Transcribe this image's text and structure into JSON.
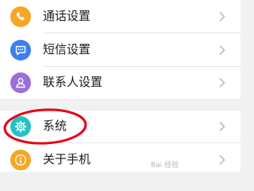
{
  "settings": {
    "items": [
      {
        "label": "通话设置",
        "icon": "phone-icon",
        "icon_color": "#f5a623"
      },
      {
        "label": "短信设置",
        "icon": "message-icon",
        "icon_color": "#3d7ef0"
      },
      {
        "label": "联系人设置",
        "icon": "contact-icon",
        "icon_color": "#9c6ed8"
      },
      {
        "label": "系统",
        "icon": "gear-icon",
        "icon_color": "#22c3c3"
      },
      {
        "label": "关于手机",
        "icon": "info-icon",
        "icon_color": "#f5a623"
      }
    ],
    "highlight_color": "#e60012"
  },
  "watermark": "Bai 经验"
}
